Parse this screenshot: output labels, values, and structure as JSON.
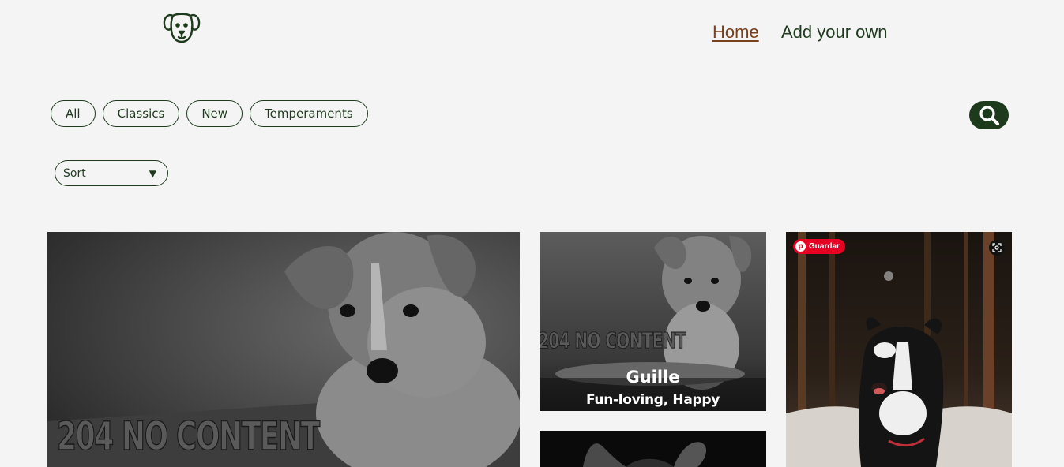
{
  "header": {
    "logo_icon": "dog-face-icon",
    "nav": {
      "home": "Home",
      "add": "Add your own"
    }
  },
  "filters": [
    "All",
    "Classics",
    "New",
    "Temperaments"
  ],
  "sort": {
    "label": "Sort",
    "icon": "triangle-down-icon"
  },
  "search": {
    "icon": "search-icon"
  },
  "cards": {
    "card1": {
      "overlay_text": "204 NO CONTENT"
    },
    "card2": {
      "overlay_text": "204 NO CONTENT",
      "name": "Guille",
      "temperaments": "Fun-loving, Happy"
    },
    "card4": {
      "pin_label": "Guardar",
      "pin_icon": "pinterest-icon",
      "lens_icon": "visual-search-icon"
    }
  },
  "colors": {
    "accent": "#1e3a1c",
    "nav_active": "#7a3f1c",
    "background": "#f4f4f4",
    "pinterest": "#e60023"
  }
}
